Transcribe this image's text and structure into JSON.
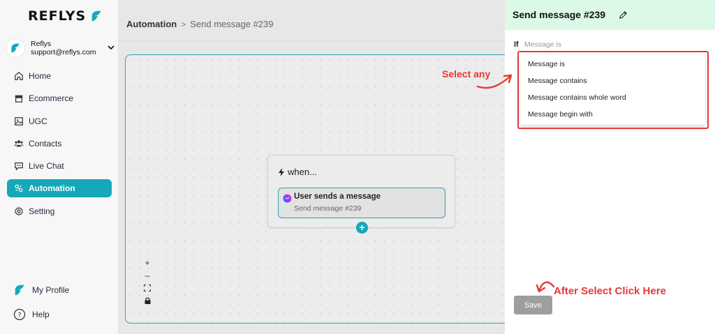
{
  "brand": {
    "name": "REFLYS"
  },
  "account": {
    "name": "Reflys",
    "email": "support@reflys.com"
  },
  "sidebar": {
    "items": [
      {
        "label": "Home",
        "icon": "home-icon"
      },
      {
        "label": "Ecommerce",
        "icon": "store-icon"
      },
      {
        "label": "UGC",
        "icon": "image-icon"
      },
      {
        "label": "Contacts",
        "icon": "users-icon"
      },
      {
        "label": "Live Chat",
        "icon": "chat-icon"
      },
      {
        "label": "Automation",
        "icon": "automation-icon",
        "active": true
      },
      {
        "label": "Setting",
        "icon": "gear-icon"
      }
    ],
    "bottom": [
      {
        "label": "My Profile",
        "icon": "profile-logo-icon"
      },
      {
        "label": "Help",
        "icon": "help-icon"
      }
    ]
  },
  "breadcrumb": {
    "parent": "Automation",
    "separator": ">",
    "current": "Send message #239"
  },
  "canvas": {
    "node": {
      "title": "when...",
      "trigger_title": "User sends a message",
      "trigger_subtitle": "Send message #239",
      "add_label": "+"
    },
    "zoom": {
      "zoom_in": "+",
      "zoom_out": "–",
      "fit": "⛶",
      "lock": "🔒"
    }
  },
  "panel": {
    "title": "Send message #239",
    "if_label": "If",
    "if_value": "Message is",
    "dropdown_options": [
      "Message is",
      "Message contains",
      "Message contains whole word",
      "Message begin with"
    ],
    "save_label": "Save"
  },
  "annotations": {
    "select_any": "Select any",
    "after_select": "After Select Click Here"
  },
  "colors": {
    "accent": "#16a8b8",
    "panel_header": "#dcf8e6",
    "annotation": "#e53935",
    "save_button": "#9e9e9e"
  }
}
